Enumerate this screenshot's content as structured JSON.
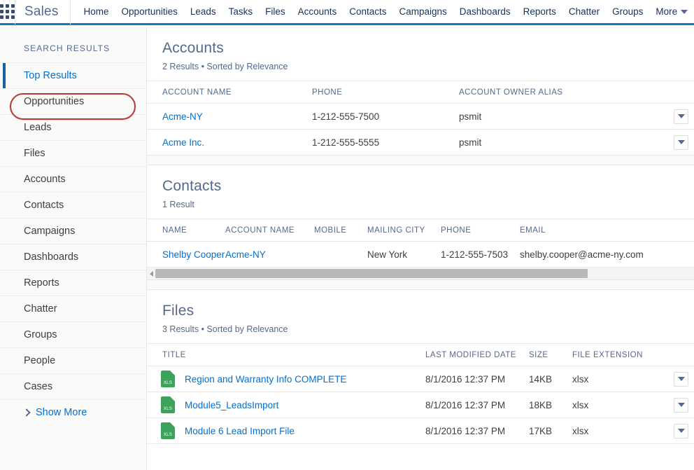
{
  "header": {
    "app_launcher_icon": "app-launcher-grid-icon",
    "app_name": "Sales",
    "nav_items": [
      {
        "label": "Home"
      },
      {
        "label": "Opportunities"
      },
      {
        "label": "Leads"
      },
      {
        "label": "Tasks"
      },
      {
        "label": "Files"
      },
      {
        "label": "Accounts"
      },
      {
        "label": "Contacts"
      },
      {
        "label": "Campaigns"
      },
      {
        "label": "Dashboards"
      },
      {
        "label": "Reports"
      },
      {
        "label": "Chatter"
      },
      {
        "label": "Groups"
      }
    ],
    "more_label": "More",
    "more_icon": "chevron-down-icon",
    "accent_color": "#1b75bb"
  },
  "sidebar": {
    "title": "SEARCH RESULTS",
    "items": [
      {
        "label": "Top Results",
        "active": true
      },
      {
        "label": "Opportunities",
        "active": false
      },
      {
        "label": "Leads",
        "active": false
      },
      {
        "label": "Files",
        "active": false
      },
      {
        "label": "Accounts",
        "active": false
      },
      {
        "label": "Contacts",
        "active": false
      },
      {
        "label": "Campaigns",
        "active": false
      },
      {
        "label": "Dashboards",
        "active": false
      },
      {
        "label": "Reports",
        "active": false
      },
      {
        "label": "Chatter",
        "active": false
      },
      {
        "label": "Groups",
        "active": false
      },
      {
        "label": "People",
        "active": false
      },
      {
        "label": "Cases",
        "active": false
      }
    ],
    "show_more_label": "Show More",
    "show_more_icon": "chevron-right-icon",
    "annotation_color": "#b33a3a",
    "active_marker_color": "#1b5f9e"
  },
  "accounts": {
    "title": "Accounts",
    "subtitle": "2 Results • Sorted by Relevance",
    "columns": [
      "ACCOUNT NAME",
      "PHONE",
      "ACCOUNT OWNER ALIAS"
    ],
    "rows": [
      {
        "name": "Acme-NY",
        "phone": "1-212-555-7500",
        "owner": "psmit",
        "menu_icon": "row-actions-chevron-down-icon"
      },
      {
        "name": "Acme Inc.",
        "phone": "1-212-555-5555",
        "owner": "psmit",
        "menu_icon": "row-actions-chevron-down-icon"
      }
    ]
  },
  "contacts": {
    "title": "Contacts",
    "subtitle": "1 Result",
    "columns": [
      "NAME",
      "ACCOUNT NAME",
      "MOBILE",
      "MAILING CITY",
      "PHONE",
      "EMAIL"
    ],
    "rows": [
      {
        "name": "Shelby Cooper",
        "account_name": "Acme-NY",
        "mobile": "",
        "mailing_city": "New York",
        "phone": "1-212-555-7503",
        "email": "shelby.cooper@acme-ny.com"
      }
    ],
    "scrollbar": {
      "left_arrow_icon": "scroll-left-arrow-icon",
      "thumb_color": "#b8b8b8"
    }
  },
  "files": {
    "title": "Files",
    "subtitle": "3 Results • Sorted by Relevance",
    "columns": [
      "TITLE",
      "LAST MODIFIED DATE",
      "SIZE",
      "FILE EXTENSION"
    ],
    "file_icon": "xls-file-icon",
    "file_icon_label": "XLS",
    "file_icon_color": "#3ca35a",
    "rows": [
      {
        "title": "Region and Warranty Info COMPLETE",
        "modified": "8/1/2016 12:37 PM",
        "size": "14KB",
        "ext": "xlsx",
        "menu_icon": "row-actions-chevron-down-icon"
      },
      {
        "title": "Module5_LeadsImport",
        "modified": "8/1/2016 12:37 PM",
        "size": "18KB",
        "ext": "xlsx",
        "menu_icon": "row-actions-chevron-down-icon"
      },
      {
        "title": "Module 6 Lead Import File",
        "modified": "8/1/2016 12:37 PM",
        "size": "17KB",
        "ext": "xlsx",
        "menu_icon": "row-actions-chevron-down-icon"
      }
    ]
  }
}
